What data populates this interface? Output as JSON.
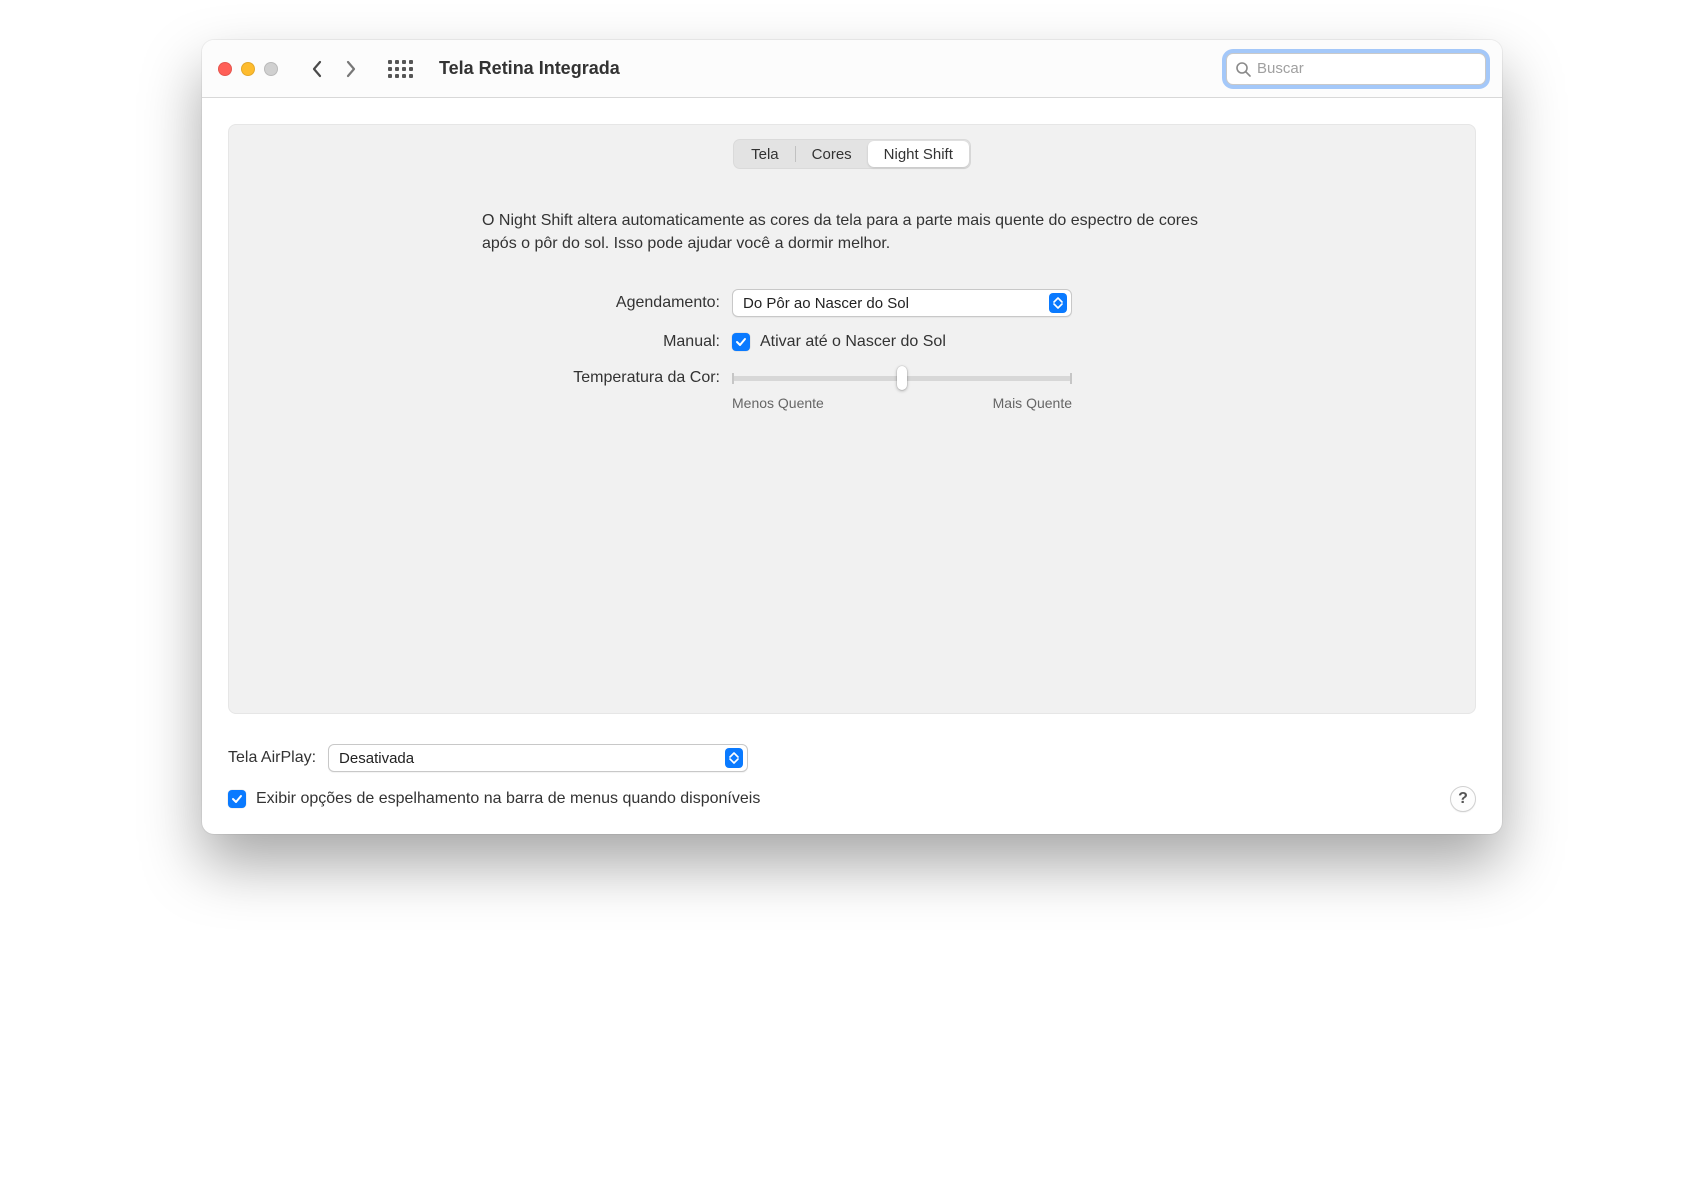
{
  "window": {
    "title": "Tela Retina Integrada",
    "search_placeholder": "Buscar"
  },
  "tabs": {
    "tela": "Tela",
    "cores": "Cores",
    "night_shift": "Night Shift"
  },
  "description": "O Night Shift altera automaticamente as cores da tela para a parte mais quente do espectro de cores após o pôr do sol. Isso pode ajudar você a dormir melhor.",
  "schedule": {
    "label": "Agendamento:",
    "value": "Do Pôr ao Nascer do Sol"
  },
  "manual": {
    "label": "Manual:",
    "checkbox_label": "Ativar até o Nascer do Sol",
    "checked": true
  },
  "color_temp": {
    "label": "Temperatura da Cor:",
    "min_label": "Menos Quente",
    "max_label": "Mais Quente"
  },
  "airplay": {
    "label": "Tela AirPlay:",
    "value": "Desativada"
  },
  "mirroring": {
    "label": "Exibir opções de espelhamento na barra de menus quando disponíveis",
    "checked": true
  },
  "help": "?"
}
